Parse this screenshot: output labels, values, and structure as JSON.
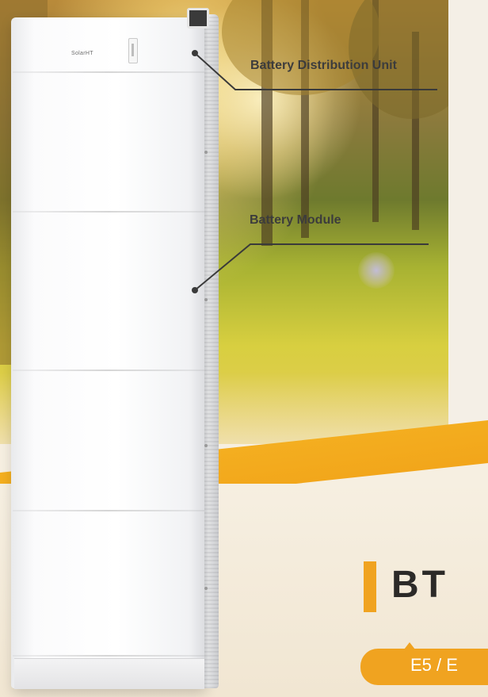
{
  "callouts": {
    "distribution_unit": "Battery Distribution Unit",
    "battery_module": "Battery Module"
  },
  "product": {
    "title": "BT",
    "model_badge": "E5 / E"
  },
  "device": {
    "brand_mark": "SolarHT"
  },
  "colors": {
    "accent": "#f0a320",
    "label_text": "#3c3c3c",
    "title_text": "#2c2a28"
  }
}
